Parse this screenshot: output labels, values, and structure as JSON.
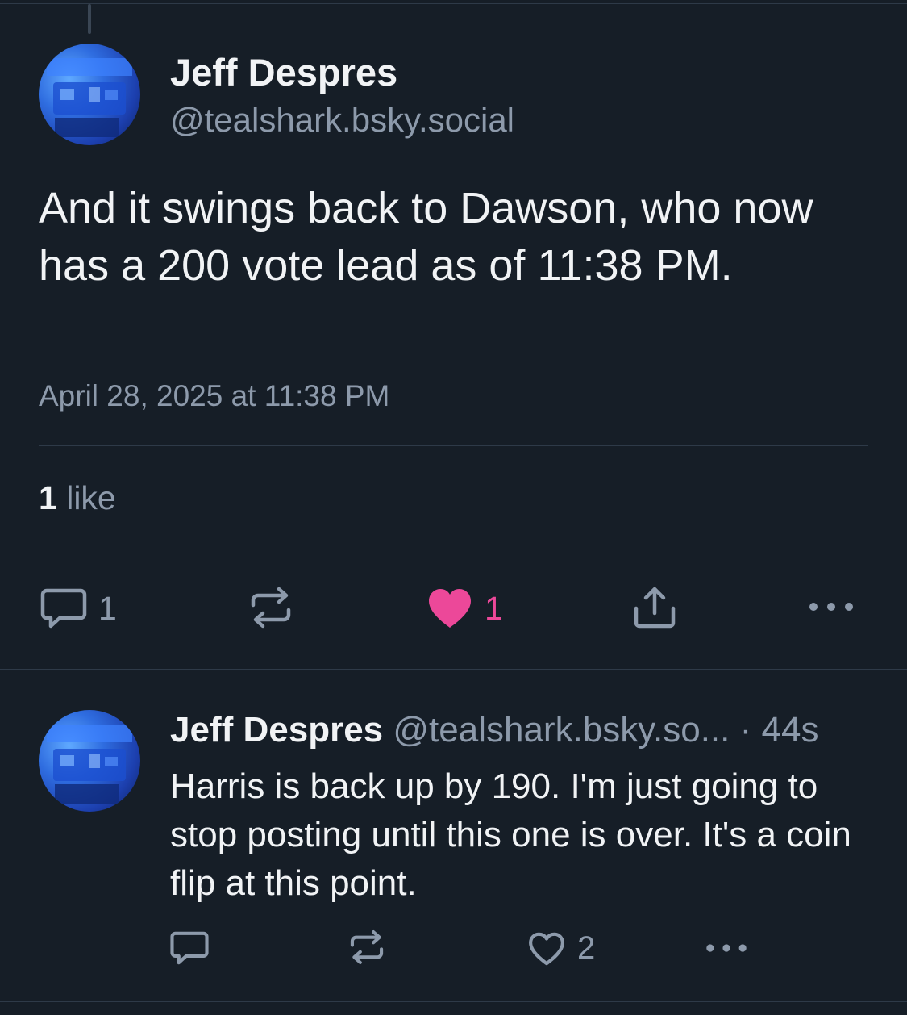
{
  "post": {
    "author_name": "Jeff Despres",
    "author_handle": "@tealshark.bsky.social",
    "text": "And it swings back to Dawson, who now has a 200 vote lead as of 11:38 PM.",
    "timestamp": "April 28, 2025 at 11:38 PM",
    "like_summary": {
      "count": "1",
      "label": "like"
    },
    "actions": {
      "reply_count": "1",
      "repost_count": "",
      "like_count": "1",
      "liked": true
    }
  },
  "reply": {
    "author_name": "Jeff Despres",
    "author_handle": "@tealshark.bsky.so...",
    "separator": "·",
    "age": "44s",
    "text": "Harris is back up by 190. I'm just going to stop posting until this one is over. It's a coin flip at this point.",
    "actions": {
      "reply_count": "",
      "repost_count": "",
      "like_count": "2"
    }
  },
  "icons": {
    "reply": "speech-bubble-icon",
    "repost": "repost-arrows-icon",
    "like": "heart-icon",
    "share": "share-upload-icon",
    "more": "more-dots-icon"
  },
  "colors": {
    "background": "#161e27",
    "text": "#f1f3f5",
    "muted": "#8d9aab",
    "like_accent": "#ec4899",
    "divider": "#2e3a48"
  }
}
